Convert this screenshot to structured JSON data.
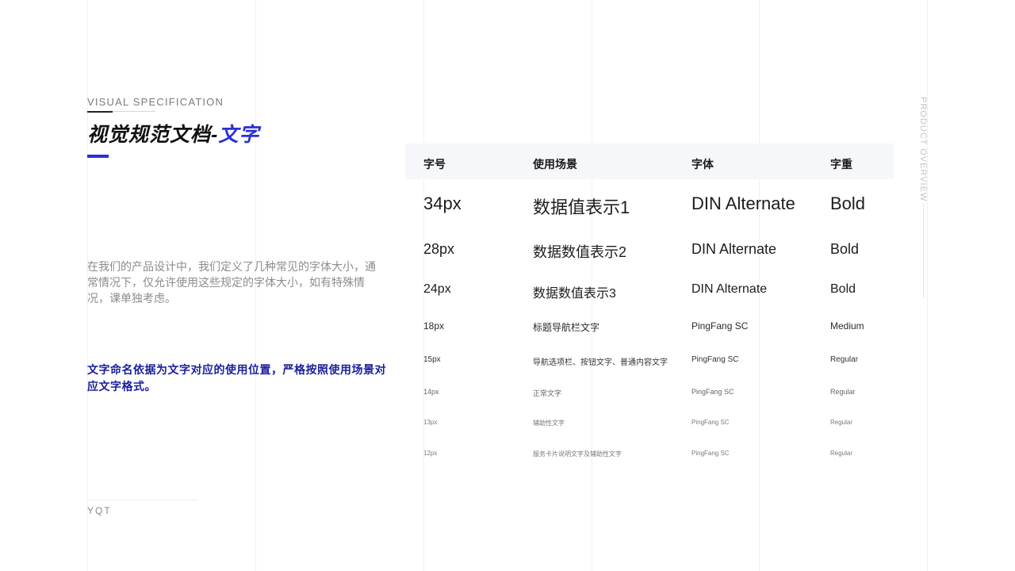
{
  "header": {
    "eyebrow": "VISUAL SPECIFICATION",
    "title_main": "视觉规范文档-",
    "title_accent": "文字",
    "accent_color": "#2a2fd6"
  },
  "intro": {
    "text": "在我们的产品设计中，我们定义了几种常见的字体大小，通常情况下，仅允许使用这些规定的字体大小，如有特殊情况，课单独考虑。"
  },
  "note": {
    "text": "文字命名依据为文字对应的使用位置，严格按照使用场景对应文字格式。",
    "color": "#1a1f9c"
  },
  "footer": {
    "brand": "YQT"
  },
  "side": {
    "label": "PRODUCT OVERVIEW"
  },
  "table": {
    "headers": [
      "字号",
      "使用场景",
      "字体",
      "字重"
    ],
    "rows": [
      [
        "34px",
        "数据值表示1",
        "DIN Alternate",
        "Bold"
      ],
      [
        "28px",
        "数据数值表示2",
        "DIN Alternate",
        "Bold"
      ],
      [
        "24px",
        "数据数值表示3",
        "DIN Alternate",
        "Bold"
      ],
      [
        "18px",
        "标题导航栏文字",
        "PingFang SC",
        "Medium"
      ],
      [
        "15px",
        "导航选项栏、按钮文字、普通内容文字",
        "PingFang SC",
        "Regular"
      ],
      [
        "14px",
        "正常文字",
        "PingFang SC",
        "Regular"
      ],
      [
        "13px",
        "辅助性文字",
        "PingFang SC",
        "Regular"
      ],
      [
        "12px",
        "服务卡片说明文字及辅助性文字",
        "PingFang SC",
        "Regular"
      ]
    ]
  }
}
